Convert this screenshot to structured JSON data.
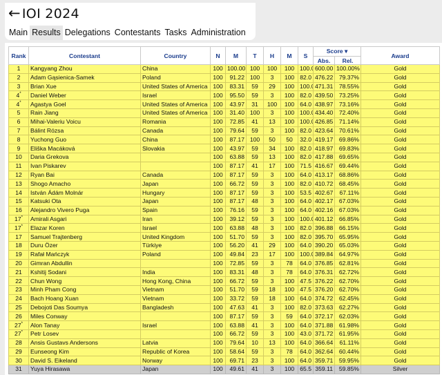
{
  "header": {
    "back_arrow": "←",
    "title": "IOI 2024",
    "tabs": [
      "Main",
      "Results",
      "Delegations",
      "Contestants",
      "Tasks",
      "Administration"
    ],
    "active_tab": "Results"
  },
  "table": {
    "columns": [
      "Rank",
      "Contestant",
      "Country",
      "N",
      "M",
      "T",
      "H",
      "M",
      "S",
      "Score",
      "Award"
    ],
    "score_group": "Score",
    "score_sort_icon": "sort-down-icon",
    "score_sort_glyph": "▾",
    "score_subcolumns": [
      "Abs.",
      "Rel."
    ],
    "rows": [
      {
        "rank": "1",
        "mark": "",
        "name": "Kangyang Zhou",
        "country": "China",
        "n": "100",
        "m": "100.00",
        "t": "100",
        "h": "100",
        "m2": "100",
        "s": "100.0",
        "abs": "600.00",
        "rel": "100.00%",
        "award": "Gold"
      },
      {
        "rank": "2",
        "mark": "",
        "name": "Adam Gąsienica-Samek",
        "country": "Poland",
        "n": "100",
        "m": "91.22",
        "t": "100",
        "h": "3",
        "m2": "100",
        "s": "82.0",
        "abs": "476.22",
        "rel": "79.37%",
        "award": "Gold"
      },
      {
        "rank": "3",
        "mark": "",
        "name": "Brian Xue",
        "country": "United States of America",
        "n": "100",
        "m": "83.31",
        "t": "59",
        "h": "29",
        "m2": "100",
        "s": "100.0",
        "abs": "471.31",
        "rel": "78.55%",
        "award": "Gold"
      },
      {
        "rank": "4",
        "mark": "*",
        "name": "Daniel Weber",
        "country": "Israel",
        "n": "100",
        "m": "95.50",
        "t": "59",
        "h": "3",
        "m2": "100",
        "s": "82.0",
        "abs": "439.50",
        "rel": "73.25%",
        "award": "Gold"
      },
      {
        "rank": "4",
        "mark": "*",
        "name": "Agastya Goel",
        "country": "United States of America",
        "n": "100",
        "m": "43.97",
        "t": "31",
        "h": "100",
        "m2": "100",
        "s": "64.0",
        "abs": "438.97",
        "rel": "73.16%",
        "award": "Gold"
      },
      {
        "rank": "5",
        "mark": "",
        "name": "Rain Jiang",
        "country": "United States of America",
        "n": "100",
        "m": "31.40",
        "t": "100",
        "h": "3",
        "m2": "100",
        "s": "100.0",
        "abs": "434.40",
        "rel": "72.40%",
        "award": "Gold"
      },
      {
        "rank": "6",
        "mark": "",
        "name": "Mihai-Valeriu Voicu",
        "country": "Romania",
        "n": "100",
        "m": "72.85",
        "t": "41",
        "h": "13",
        "m2": "100",
        "s": "100.0",
        "abs": "426.85",
        "rel": "71.14%",
        "award": "Gold"
      },
      {
        "rank": "7",
        "mark": "",
        "name": "Bálint Rózsa",
        "country": "Canada",
        "n": "100",
        "m": "79.64",
        "t": "59",
        "h": "3",
        "m2": "100",
        "s": "82.0",
        "abs": "423.64",
        "rel": "70.61%",
        "award": "Gold"
      },
      {
        "rank": "8",
        "mark": "",
        "name": "Yuchong Guo",
        "country": "China",
        "n": "100",
        "m": "87.17",
        "t": "100",
        "h": "50",
        "m2": "50",
        "s": "32.0",
        "abs": "419.17",
        "rel": "69.86%",
        "award": "Gold"
      },
      {
        "rank": "9",
        "mark": "",
        "name": "Eliška Macáková",
        "country": "Slovakia",
        "n": "100",
        "m": "43.97",
        "t": "59",
        "h": "34",
        "m2": "100",
        "s": "82.0",
        "abs": "418.97",
        "rel": "69.83%",
        "award": "Gold"
      },
      {
        "rank": "10",
        "mark": "",
        "name": "Daria Grekova",
        "country": "",
        "n": "100",
        "m": "63.88",
        "t": "59",
        "h": "13",
        "m2": "100",
        "s": "82.0",
        "abs": "417.88",
        "rel": "69.65%",
        "award": "Gold"
      },
      {
        "rank": "11",
        "mark": "",
        "name": "Ivan Piskarev",
        "country": "",
        "n": "100",
        "m": "87.17",
        "t": "41",
        "h": "17",
        "m2": "100",
        "s": "71.5",
        "abs": "416.67",
        "rel": "69.44%",
        "award": "Gold"
      },
      {
        "rank": "12",
        "mark": "",
        "name": "Ryan Bai",
        "country": "Canada",
        "n": "100",
        "m": "87.17",
        "t": "59",
        "h": "3",
        "m2": "100",
        "s": "64.0",
        "abs": "413.17",
        "rel": "68.86%",
        "award": "Gold"
      },
      {
        "rank": "13",
        "mark": "",
        "name": "Shogo Amacho",
        "country": "Japan",
        "n": "100",
        "m": "66.72",
        "t": "59",
        "h": "3",
        "m2": "100",
        "s": "82.0",
        "abs": "410.72",
        "rel": "68.45%",
        "award": "Gold"
      },
      {
        "rank": "14",
        "mark": "",
        "name": "István Ádám Molnár",
        "country": "Hungary",
        "n": "100",
        "m": "87.17",
        "t": "59",
        "h": "3",
        "m2": "100",
        "s": "53.5",
        "abs": "402.67",
        "rel": "67.11%",
        "award": "Gold"
      },
      {
        "rank": "15",
        "mark": "",
        "name": "Katsuki Ota",
        "country": "Japan",
        "n": "100",
        "m": "87.17",
        "t": "48",
        "h": "3",
        "m2": "100",
        "s": "64.0",
        "abs": "402.17",
        "rel": "67.03%",
        "award": "Gold"
      },
      {
        "rank": "16",
        "mark": "",
        "name": "Alejandro Vivero Puga",
        "country": "Spain",
        "n": "100",
        "m": "76.16",
        "t": "59",
        "h": "3",
        "m2": "100",
        "s": "64.0",
        "abs": "402.16",
        "rel": "67.03%",
        "award": "Gold"
      },
      {
        "rank": "17",
        "mark": "*",
        "name": "Amirali Asgari",
        "country": "Iran",
        "n": "100",
        "m": "39.12",
        "t": "59",
        "h": "3",
        "m2": "100",
        "s": "100.0",
        "abs": "401.12",
        "rel": "66.85%",
        "award": "Gold"
      },
      {
        "rank": "17",
        "mark": "*",
        "name": "Elazar Koren",
        "country": "Israel",
        "n": "100",
        "m": "63.88",
        "t": "48",
        "h": "3",
        "m2": "100",
        "s": "82.0",
        "abs": "396.88",
        "rel": "66.15%",
        "award": "Gold"
      },
      {
        "rank": "17",
        "mark": "",
        "name": "Samuel Trajtenberg",
        "country": "United Kingdom",
        "n": "100",
        "m": "51.70",
        "t": "59",
        "h": "3",
        "m2": "100",
        "s": "82.0",
        "abs": "395.70",
        "rel": "65.95%",
        "award": "Gold"
      },
      {
        "rank": "18",
        "mark": "",
        "name": "Duru Özer",
        "country": "Türkiye",
        "n": "100",
        "m": "56.20",
        "t": "41",
        "h": "29",
        "m2": "100",
        "s": "64.0",
        "abs": "390.20",
        "rel": "65.03%",
        "award": "Gold"
      },
      {
        "rank": "19",
        "mark": "",
        "name": "Rafał Mańczyk",
        "country": "Poland",
        "n": "100",
        "m": "49.84",
        "t": "23",
        "h": "17",
        "m2": "100",
        "s": "100.0",
        "abs": "389.84",
        "rel": "64.97%",
        "award": "Gold"
      },
      {
        "rank": "20",
        "mark": "",
        "name": "Gimran Abdullin",
        "country": "",
        "n": "100",
        "m": "72.85",
        "t": "59",
        "h": "3",
        "m2": "78",
        "s": "64.0",
        "abs": "376.85",
        "rel": "62.81%",
        "award": "Gold"
      },
      {
        "rank": "21",
        "mark": "",
        "name": "Kshitij Sodani",
        "country": "India",
        "n": "100",
        "m": "83.31",
        "t": "48",
        "h": "3",
        "m2": "78",
        "s": "64.0",
        "abs": "376.31",
        "rel": "62.72%",
        "award": "Gold"
      },
      {
        "rank": "22",
        "mark": "",
        "name": "Chun Wong",
        "country": "Hong Kong, China",
        "n": "100",
        "m": "66.72",
        "t": "59",
        "h": "3",
        "m2": "100",
        "s": "47.5",
        "abs": "376.22",
        "rel": "62.70%",
        "award": "Gold"
      },
      {
        "rank": "23",
        "mark": "",
        "name": "Minh Pham Cong",
        "country": "Vietnam",
        "n": "100",
        "m": "51.70",
        "t": "59",
        "h": "18",
        "m2": "100",
        "s": "47.5",
        "abs": "376.20",
        "rel": "62.70%",
        "award": "Gold"
      },
      {
        "rank": "24",
        "mark": "",
        "name": "Bach Hoang Xuan",
        "country": "Vietnam",
        "n": "100",
        "m": "33.72",
        "t": "59",
        "h": "18",
        "m2": "100",
        "s": "64.0",
        "abs": "374.72",
        "rel": "62.45%",
        "award": "Gold"
      },
      {
        "rank": "25",
        "mark": "",
        "name": "Debojoti Das Soumya",
        "country": "Bangladesh",
        "n": "100",
        "m": "47.63",
        "t": "41",
        "h": "3",
        "m2": "100",
        "s": "82.0",
        "abs": "373.63",
        "rel": "62.27%",
        "award": "Gold"
      },
      {
        "rank": "26",
        "mark": "",
        "name": "Miles Conway",
        "country": "",
        "n": "100",
        "m": "87.17",
        "t": "59",
        "h": "3",
        "m2": "59",
        "s": "64.0",
        "abs": "372.17",
        "rel": "62.03%",
        "award": "Gold"
      },
      {
        "rank": "27",
        "mark": "*",
        "name": "Alon Tanay",
        "country": "Israel",
        "n": "100",
        "m": "63.88",
        "t": "41",
        "h": "3",
        "m2": "100",
        "s": "64.0",
        "abs": "371.88",
        "rel": "61.98%",
        "award": "Gold"
      },
      {
        "rank": "27",
        "mark": "*",
        "name": "Petr Losev",
        "country": "",
        "n": "100",
        "m": "66.72",
        "t": "59",
        "h": "3",
        "m2": "100",
        "s": "43.0",
        "abs": "371.72",
        "rel": "61.95%",
        "award": "Gold"
      },
      {
        "rank": "28",
        "mark": "",
        "name": "Ansis Gustavs Andersons",
        "country": "Latvia",
        "n": "100",
        "m": "79.64",
        "t": "10",
        "h": "13",
        "m2": "100",
        "s": "64.0",
        "abs": "366.64",
        "rel": "61.11%",
        "award": "Gold"
      },
      {
        "rank": "29",
        "mark": "",
        "name": "Eunseong Kim",
        "country": "Republic of Korea",
        "n": "100",
        "m": "58.64",
        "t": "59",
        "h": "3",
        "m2": "78",
        "s": "64.0",
        "abs": "362.64",
        "rel": "60.44%",
        "award": "Gold"
      },
      {
        "rank": "30",
        "mark": "",
        "name": "David S. Eikeland",
        "country": "Norway",
        "n": "100",
        "m": "69.71",
        "t": "23",
        "h": "3",
        "m2": "100",
        "s": "64.0",
        "abs": "359.71",
        "rel": "59.95%",
        "award": "Gold"
      },
      {
        "rank": "31",
        "mark": "",
        "name": "Yuya Hirasawa",
        "country": "Japan",
        "n": "100",
        "m": "49.61",
        "t": "41",
        "h": "3",
        "m2": "100",
        "s": "65.5",
        "abs": "359.11",
        "rel": "59.85%",
        "award": "Silver"
      }
    ]
  },
  "colors": {
    "gold_row": "#fdfb78",
    "silver_row": "#cfcfcf",
    "header_text": "#1a3c8c"
  }
}
